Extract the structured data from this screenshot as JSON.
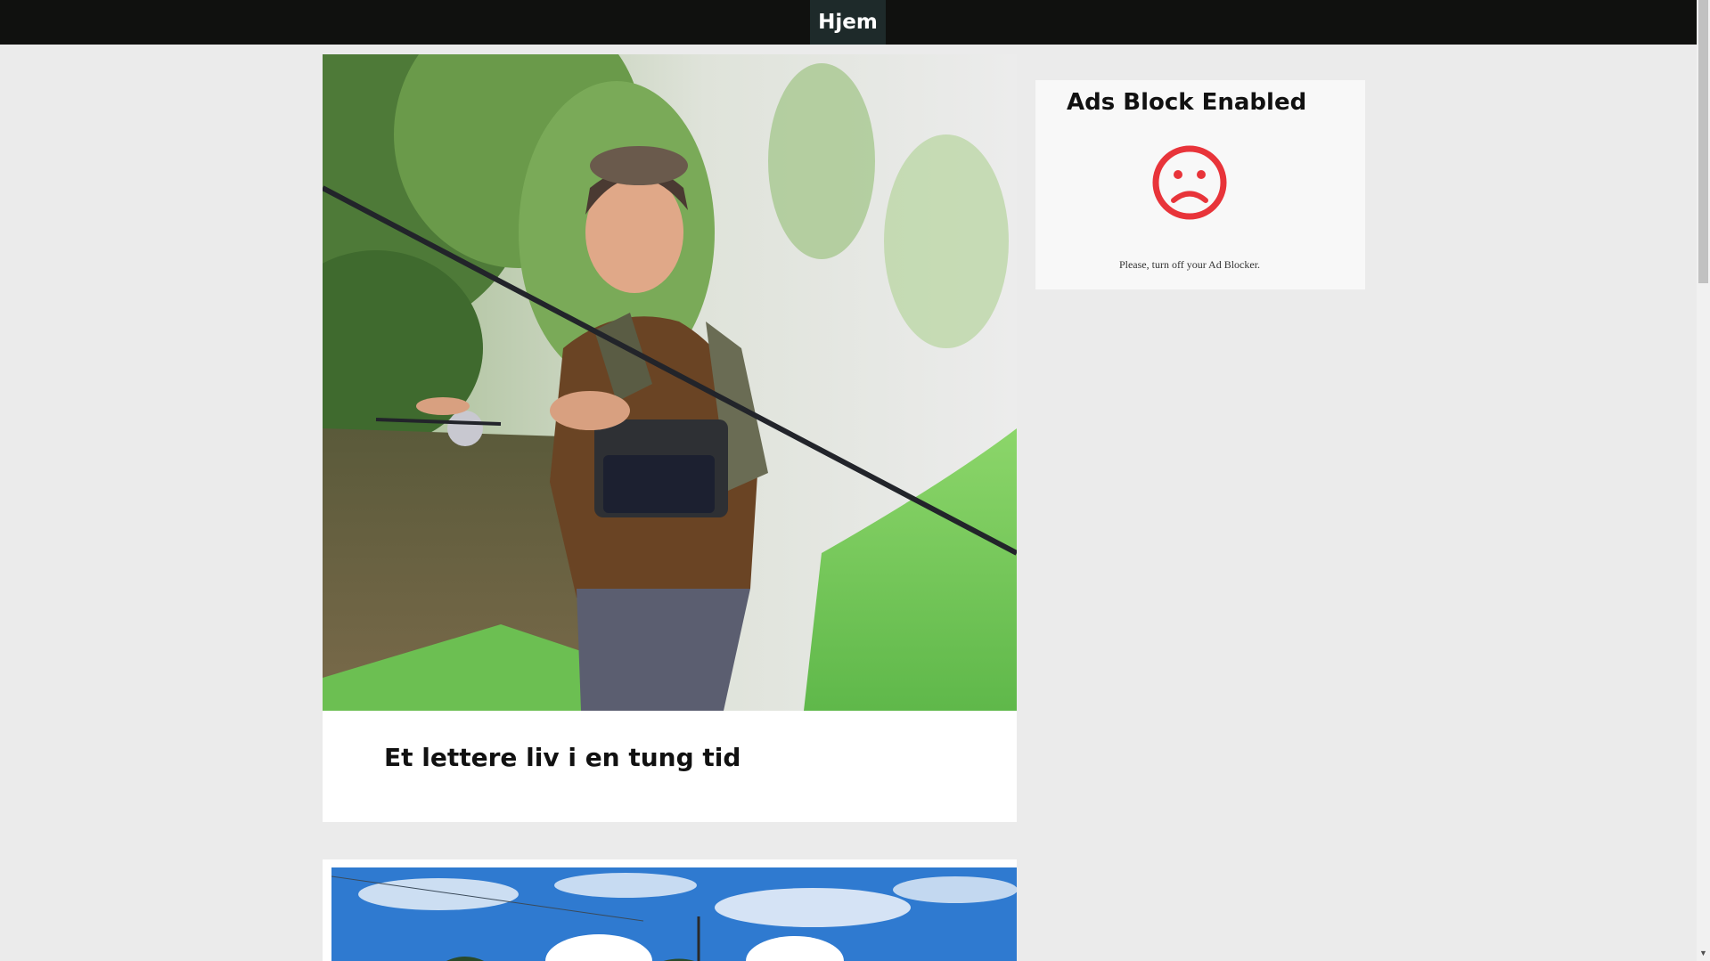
{
  "nav": {
    "home_label": "Hjem"
  },
  "posts": [
    {
      "title": "Et lettere liv i en tung tid",
      "image": "man-fly-fishing-by-river-photo"
    },
    {
      "title": "",
      "image": "blue-sky-clouds-landscape-photo"
    }
  ],
  "ad_block": {
    "title": "Ads Block Enabled",
    "icon": "sad-face-icon",
    "message": "Please, turn off your Ad Blocker."
  },
  "colors": {
    "topbar": "#10110f",
    "nav_active": "#1e2a2a",
    "page_bg": "#ebebeb",
    "sad_icon": "#e8343a"
  }
}
